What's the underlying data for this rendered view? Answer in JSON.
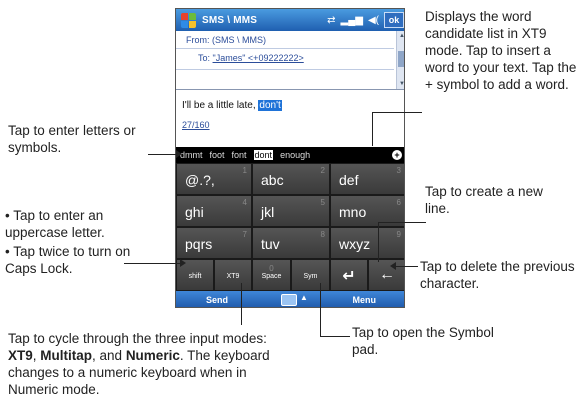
{
  "phone": {
    "titlebar": {
      "title": "SMS \\ MMS",
      "ok_label": "ok",
      "sync_icon": "sync-icon",
      "signal_icon": "signal-icon",
      "volume_icon": "volume-icon"
    },
    "message": {
      "from_label": "From:",
      "from_value": "(SMS \\ MMS)",
      "to_label": "To:",
      "to_value": "\"James\" <+09222222>",
      "body_text": "I'll be a little late, ",
      "selected_word": "don't",
      "char_count": "27/160"
    },
    "candidates": [
      "dmmt",
      "foot",
      "font",
      "dont",
      "enough"
    ],
    "candidates_selected_index": 3,
    "plus_symbol": "+",
    "keyboard": {
      "rows": [
        [
          {
            "label": "@.?,",
            "num": "1"
          },
          {
            "label": "abc",
            "num": "2"
          },
          {
            "label": "def",
            "num": "3"
          }
        ],
        [
          {
            "label": "ghi",
            "num": "4"
          },
          {
            "label": "jkl",
            "num": "5"
          },
          {
            "label": "mno",
            "num": "6"
          }
        ],
        [
          {
            "label": "pqrs",
            "num": "7"
          },
          {
            "label": "tuv",
            "num": "8"
          },
          {
            "label": "wxyz",
            "num": "9"
          }
        ]
      ],
      "bottom_row": {
        "shift": "shift",
        "xt9": "XT9",
        "space": "Space",
        "space_num": "0",
        "sym": "Sym",
        "enter_icon": "enter-icon",
        "backspace_icon": "backspace-icon"
      }
    },
    "softkeys": {
      "left": "Send",
      "right": "Menu",
      "sip_icon": "keyboard-icon"
    }
  },
  "callouts": {
    "candidate_list": "Displays the word candidate list in XT9 mode. Tap to insert a word to your text. Tap the + symbol to add a word.",
    "enter_letters": "Tap to enter letters or symbols.",
    "uppercase_1": "• Tap to enter an uppercase letter.",
    "uppercase_2": "• Tap twice to turn on Caps Lock.",
    "new_line": "Tap to create a new line.",
    "delete_char": "Tap to delete the previous character.",
    "cycle_modes_pre": "Tap to cycle through the three input modes: ",
    "mode_xt9": "XT9",
    "mode_sep1": ", ",
    "mode_multitap": "Multitap",
    "mode_sep2": ", and ",
    "mode_numeric": "Numeric",
    "cycle_modes_post": ". The keyboard changes to a numeric keyboard when in Numeric mode.",
    "symbol_pad": "Tap to open the Symbol pad."
  },
  "colors": {
    "title_blue": "#1f5fb0",
    "select_blue": "#1f73d8",
    "key_gray": "#444444"
  }
}
